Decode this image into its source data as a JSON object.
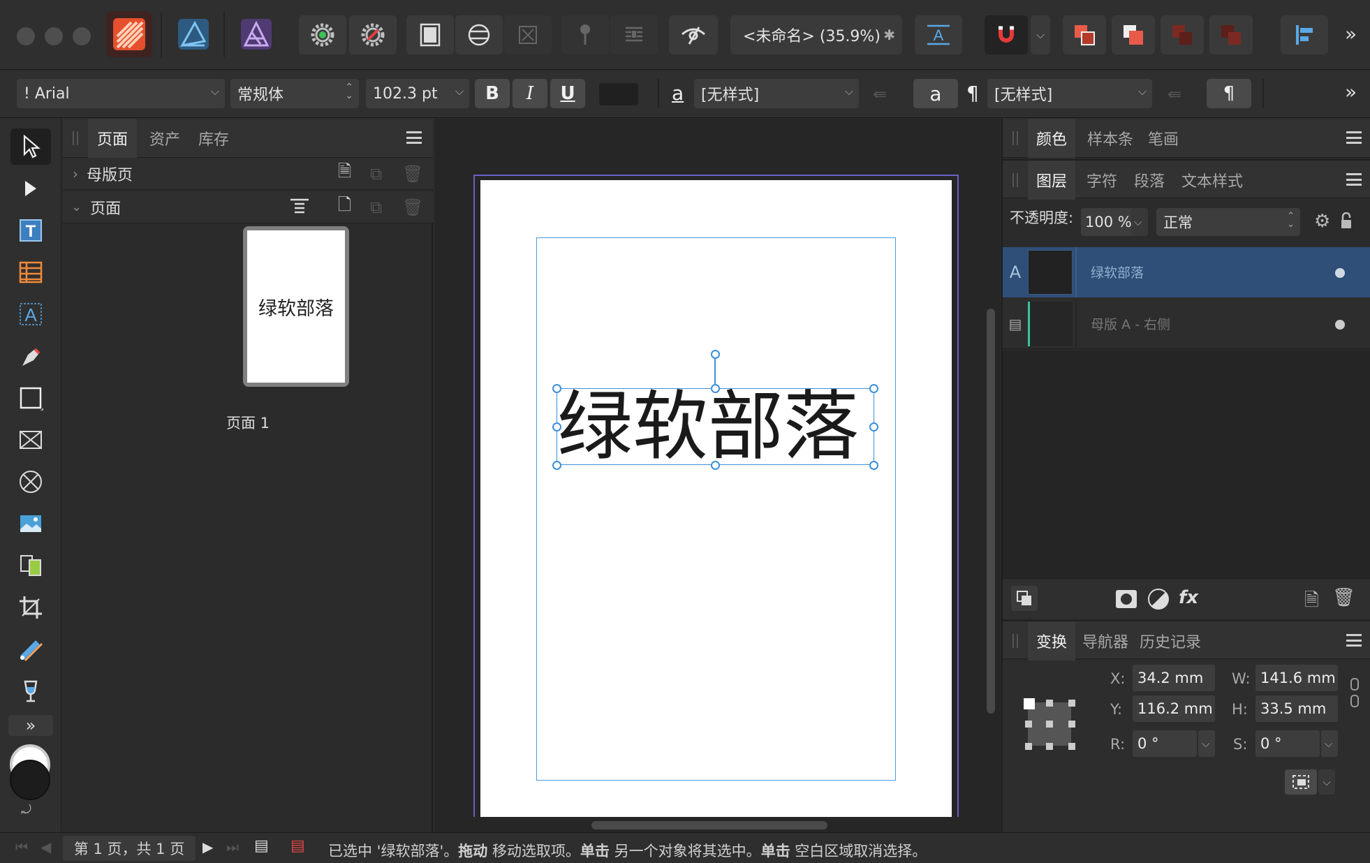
{
  "window": {
    "document_title": "<未命名> (35.9%)",
    "close_mark": "✱"
  },
  "context_bar": {
    "font_family": "! Arial",
    "font_style": "常规体",
    "font_size": "102.3 pt",
    "bold": "B",
    "italic": "I",
    "underline": "U",
    "char_style_glyph": "a",
    "char_style": "[无样式]",
    "char_style_btn": "a",
    "para_glyph": "¶",
    "para_style": "[无样式]",
    "para_style_btn": "¶"
  },
  "left_panel": {
    "tabs": [
      "页面",
      "资产",
      "库存"
    ],
    "master_section": "母版页",
    "pages_section": "页面",
    "thumb_text": "绿软部落",
    "page_label": "页面 1"
  },
  "right_top": {
    "tabs": [
      "颜色",
      "样本条",
      "笔画"
    ]
  },
  "layers_panel": {
    "tabs": [
      "图层",
      "字符",
      "段落",
      "文本样式"
    ],
    "opacity_label": "不透明度:",
    "opacity_value": "100 %",
    "blend_mode": "正常",
    "layers": [
      {
        "type_glyph": "A",
        "name": "绿软部落"
      },
      {
        "type_glyph": "▤",
        "name": "母版 A - 右侧"
      }
    ]
  },
  "transform_panel": {
    "tabs": [
      "变换",
      "导航器",
      "历史记录"
    ],
    "x_label": "X:",
    "x_value": "34.2 mm",
    "y_label": "Y:",
    "y_value": "116.2 mm",
    "w_label": "W:",
    "w_value": "141.6 mm",
    "h_label": "H:",
    "h_value": "33.5 mm",
    "r_label": "R:",
    "r_value": "0 °",
    "s_label": "S:",
    "s_value": "0 °"
  },
  "canvas": {
    "text": "绿软部落"
  },
  "status_bar": {
    "page_info": "第 1 页，共 1 页",
    "msg1": "已选中 '绿软部落'。",
    "msg2": "拖动",
    "msg3": " 移动选取项。",
    "msg4": "单击",
    "msg5": " 另一个对象将其选中。",
    "msg6": "单击",
    "msg7": " 空白区域取消选择。"
  },
  "colors": {
    "accent": "#3c8fd9",
    "selected_layer": "#2f4f78",
    "publisher_brand": "#e6502e",
    "designer_brand": "#3f7fae",
    "photo_brand": "#6a4d96"
  }
}
